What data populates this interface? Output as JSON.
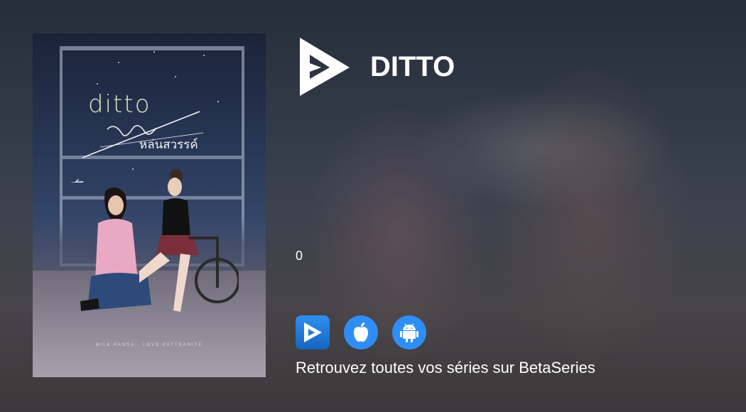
{
  "show": {
    "title": "DITTO",
    "count": "0"
  },
  "poster": {
    "title": "ditto",
    "thai_subtitle": "หล่นสวรรค์",
    "credits": "MILK PANSA · LOVE PATTRANITE"
  },
  "apps": [
    {
      "name": "BetaSeries",
      "icon": "betaseries-logo-icon"
    },
    {
      "name": "App Store",
      "icon": "apple-icon"
    },
    {
      "name": "Google Play",
      "icon": "android-icon"
    }
  ],
  "tagline": "Retrouvez toutes vos séries sur BetaSeries",
  "colors": {
    "accent": "#2f8ef6",
    "text": "#ffffff"
  }
}
